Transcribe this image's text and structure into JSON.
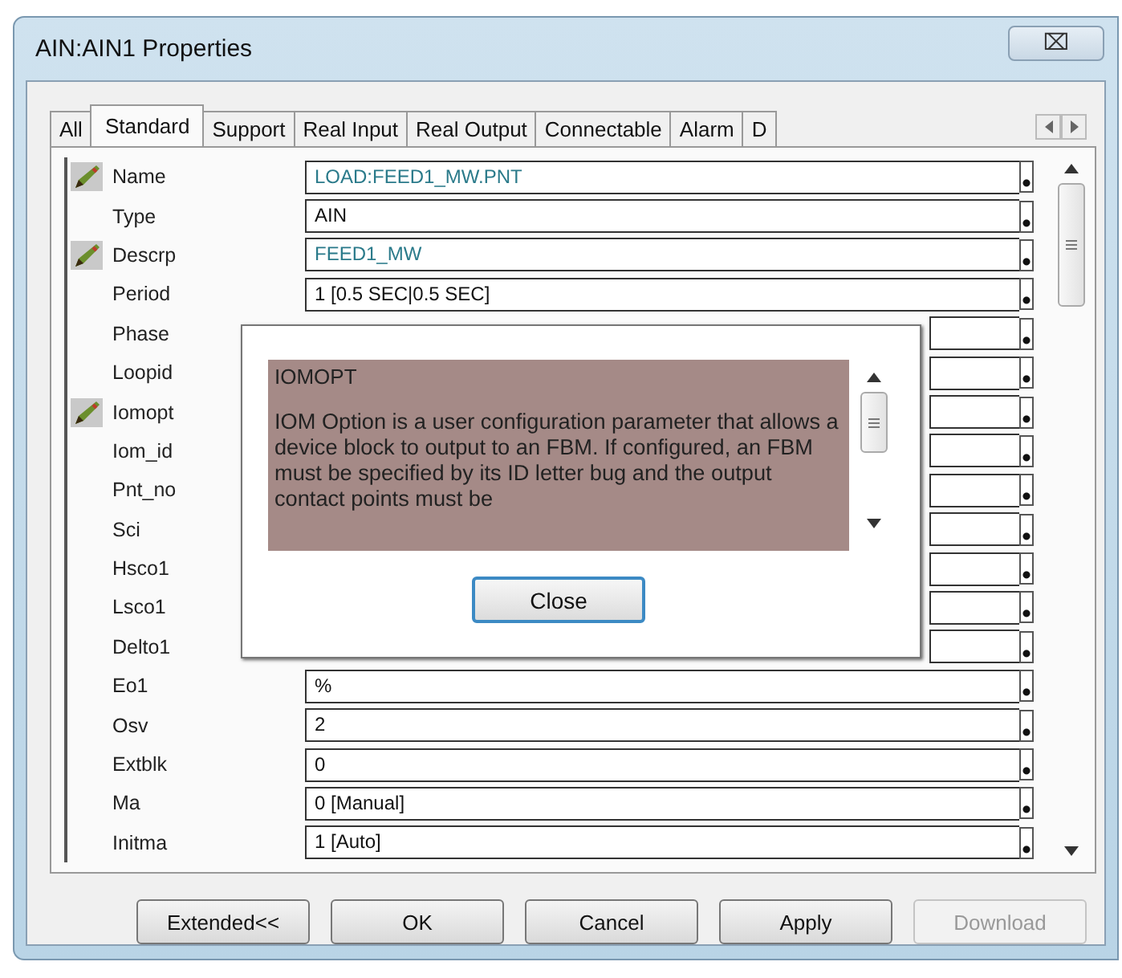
{
  "window": {
    "title": "AIN:AIN1 Properties",
    "close": "⌧"
  },
  "tabs": [
    {
      "label": "All",
      "selected": false
    },
    {
      "label": "Standard",
      "selected": true
    },
    {
      "label": "Support",
      "selected": false
    },
    {
      "label": "Real Input",
      "selected": false
    },
    {
      "label": "Real Output",
      "selected": false
    },
    {
      "label": "Connectable",
      "selected": false
    },
    {
      "label": "Alarm",
      "selected": false
    },
    {
      "label": "D",
      "selected": false
    }
  ],
  "properties": [
    {
      "name": "Name",
      "value": "LOAD:FEED1_MW.PNT",
      "edited": true
    },
    {
      "name": "Type",
      "value": "AIN",
      "edited": false
    },
    {
      "name": "Descrp",
      "value": "FEED1_MW",
      "edited": true
    },
    {
      "name": "Period",
      "value": "1 [0.5 SEC|0.5 SEC]",
      "edited": false
    },
    {
      "name": "Phase",
      "edited": false
    },
    {
      "name": "Loopid",
      "edited": false
    },
    {
      "name": "Iomopt",
      "edited": true
    },
    {
      "name": "Iom_id",
      "edited": false
    },
    {
      "name": "Pnt_no",
      "edited": false
    },
    {
      "name": "Sci",
      "edited": false
    },
    {
      "name": "Hsco1",
      "edited": false
    },
    {
      "name": "Lsco1",
      "edited": false
    },
    {
      "name": "Delto1",
      "edited": false
    },
    {
      "name": "Eo1",
      "value": "%",
      "edited": false
    },
    {
      "name": "Osv",
      "value": "2",
      "edited": false
    },
    {
      "name": "Extblk",
      "value": "0",
      "edited": false
    },
    {
      "name": "Ma",
      "value": "0 [Manual]",
      "edited": false
    },
    {
      "name": "Initma",
      "value": "1 [Auto]",
      "edited": false
    }
  ],
  "help_popup": {
    "heading": "IOMOPT",
    "text": "IOM Option is a user configuration parameter that allows a device block to output to an FBM. If configured, an FBM must be specified by its ID letter bug and the output contact points must be",
    "button": "Close"
  },
  "buttons": [
    {
      "label": "Extended<<",
      "disabled": false
    },
    {
      "label": "OK",
      "disabled": false
    },
    {
      "label": "Cancel",
      "disabled": false
    },
    {
      "label": "Apply",
      "disabled": false
    },
    {
      "label": "Download",
      "disabled": true
    }
  ]
}
